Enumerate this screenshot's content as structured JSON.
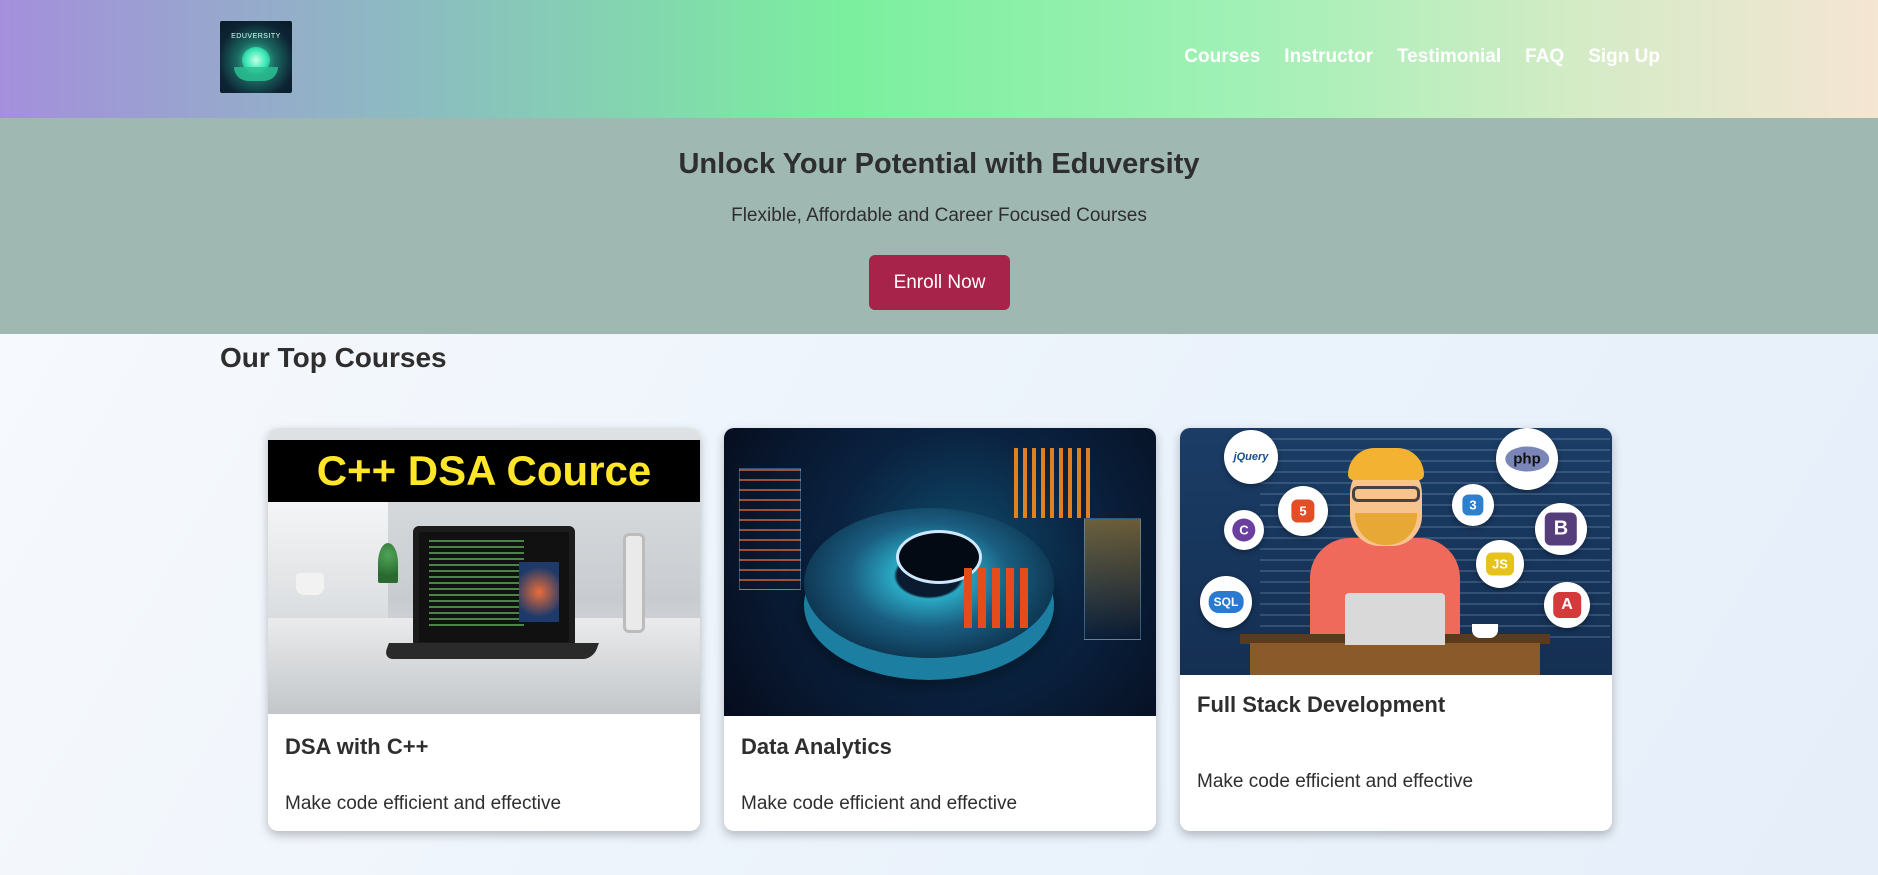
{
  "header": {
    "logo_text": "EDUVERSITY",
    "nav": [
      "Courses",
      "Instructor",
      "Testimonial",
      "FAQ",
      "Sign Up"
    ]
  },
  "hero": {
    "title": "Unlock Your Potential with Eduversity",
    "subtitle": "Flexible, Affordable and Career Focused Courses",
    "cta": "Enroll Now"
  },
  "courses": {
    "section_title": "Our Top Courses",
    "items": [
      {
        "image_text": "C++ DSA Cource",
        "title": "DSA with C++",
        "description": "Make code efficient and effective"
      },
      {
        "title": "Data Analytics",
        "description": "Make code efficient and effective"
      },
      {
        "title": "Full Stack Development",
        "description": "Make code efficient and effective",
        "image_badges": [
          "jQuery",
          "php",
          "5",
          "3",
          "C",
          "B",
          "JS",
          "SQL",
          "A"
        ]
      }
    ]
  },
  "colors": {
    "accent_button": "#a8234a",
    "hero_bg": "#9fb8b2"
  }
}
